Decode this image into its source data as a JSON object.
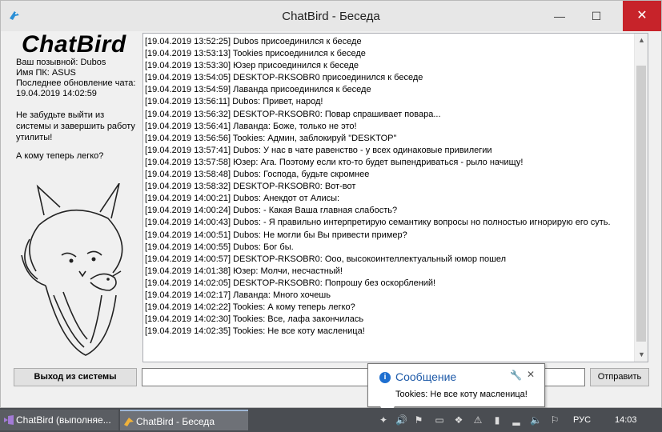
{
  "window": {
    "title": "ChatBird - Беседа",
    "minimize": "—",
    "maximize": "☐",
    "close": "✕"
  },
  "left": {
    "brand": "ChatBird",
    "callsign": "Ваш позывной: Dubos",
    "pc_name": "Имя ПК: ASUS",
    "last_update_label": "Последнее обновление чата:",
    "last_update_value": "19.04.2019 14:02:59",
    "reminder": "Не забудьте выйти из системы и завершить работу утилиты!",
    "question": "А кому теперь легко?"
  },
  "chat": {
    "lines": [
      "[19.04.2019 13:52:25] Dubos присоединился к беседе",
      "[19.04.2019 13:53:13] Tookies присоединился к беседе",
      "[19.04.2019 13:53:30] Юзер присоединился к беседе",
      "[19.04.2019 13:54:05] DESKTOP-RKSOBR0 присоединился к беседе",
      "[19.04.2019 13:54:59] Лаванда присоединился к беседе",
      "[19.04.2019 13:56:11] Dubos: Привет, народ!",
      "[19.04.2019 13:56:32] DESKTOP-RKSOBR0: Повар спрашивает повара...",
      "[19.04.2019 13:56:41] Лаванда: Боже, только не это!",
      "[19.04.2019 13:56:56] Tookies: Админ, заблокируй \"DESKTOP\"",
      "[19.04.2019 13:57:41] Dubos: У нас в чате равенство - у всех одинаковые привилегии",
      "[19.04.2019 13:57:58] Юзер: Ага. Поэтому если кто-то будет выпендриваться - рыло начищу!",
      "[19.04.2019 13:58:48] Dubos: Господа, будьте скромнее",
      "[19.04.2019 13:58:32] DESKTOP-RKSOBR0: Вот-вот",
      "[19.04.2019 14:00:21] Dubos: Анекдот от Алисы:",
      "[19.04.2019 14:00:24] Dubos:  - Какая Ваша главная слабость?",
      "[19.04.2019 14:00:43] Dubos:  - Я правильно интерпретирую семантику вопросы но полностью игнорирую его суть.",
      "[19.04.2019 14:00:51] Dubos: Не могли бы Вы привести пример?",
      "[19.04.2019 14:00:55] Dubos: Бог бы.",
      "[19.04.2019 14:00:57] DESKTOP-RKSOBR0: Ооо, высокоинтеллектуальный юмор пошел",
      "[19.04.2019 14:01:38] Юзер: Молчи, несчастный!",
      "[19.04.2019 14:02:05] DESKTOP-RKSOBR0: Попрошу без оскорблений!",
      "[19.04.2019 14:02:17] Лаванда: Много хочешь",
      "[19.04.2019 14:02:22] Tookies: А кому теперь легко?",
      "[19.04.2019 14:02:30] Tookies: Все, лафа закончилась",
      "[19.04.2019 14:02:35] Tookies: Не все коту масленица!"
    ]
  },
  "controls": {
    "logout_label": "Выход из системы",
    "message_value": "",
    "send_label": "Отправить"
  },
  "notification": {
    "title": "Сообщение",
    "text": "Tookies: Не все коту масленица!"
  },
  "taskbar": {
    "task1": "ChatBird (выполняе...",
    "task2": "ChatBird - Беседа",
    "language": "РУС",
    "time": "14:03"
  },
  "colors": {
    "close_button": "#c7232a",
    "notification_title": "#1e5aa8",
    "taskbar": "#4a4d52"
  }
}
